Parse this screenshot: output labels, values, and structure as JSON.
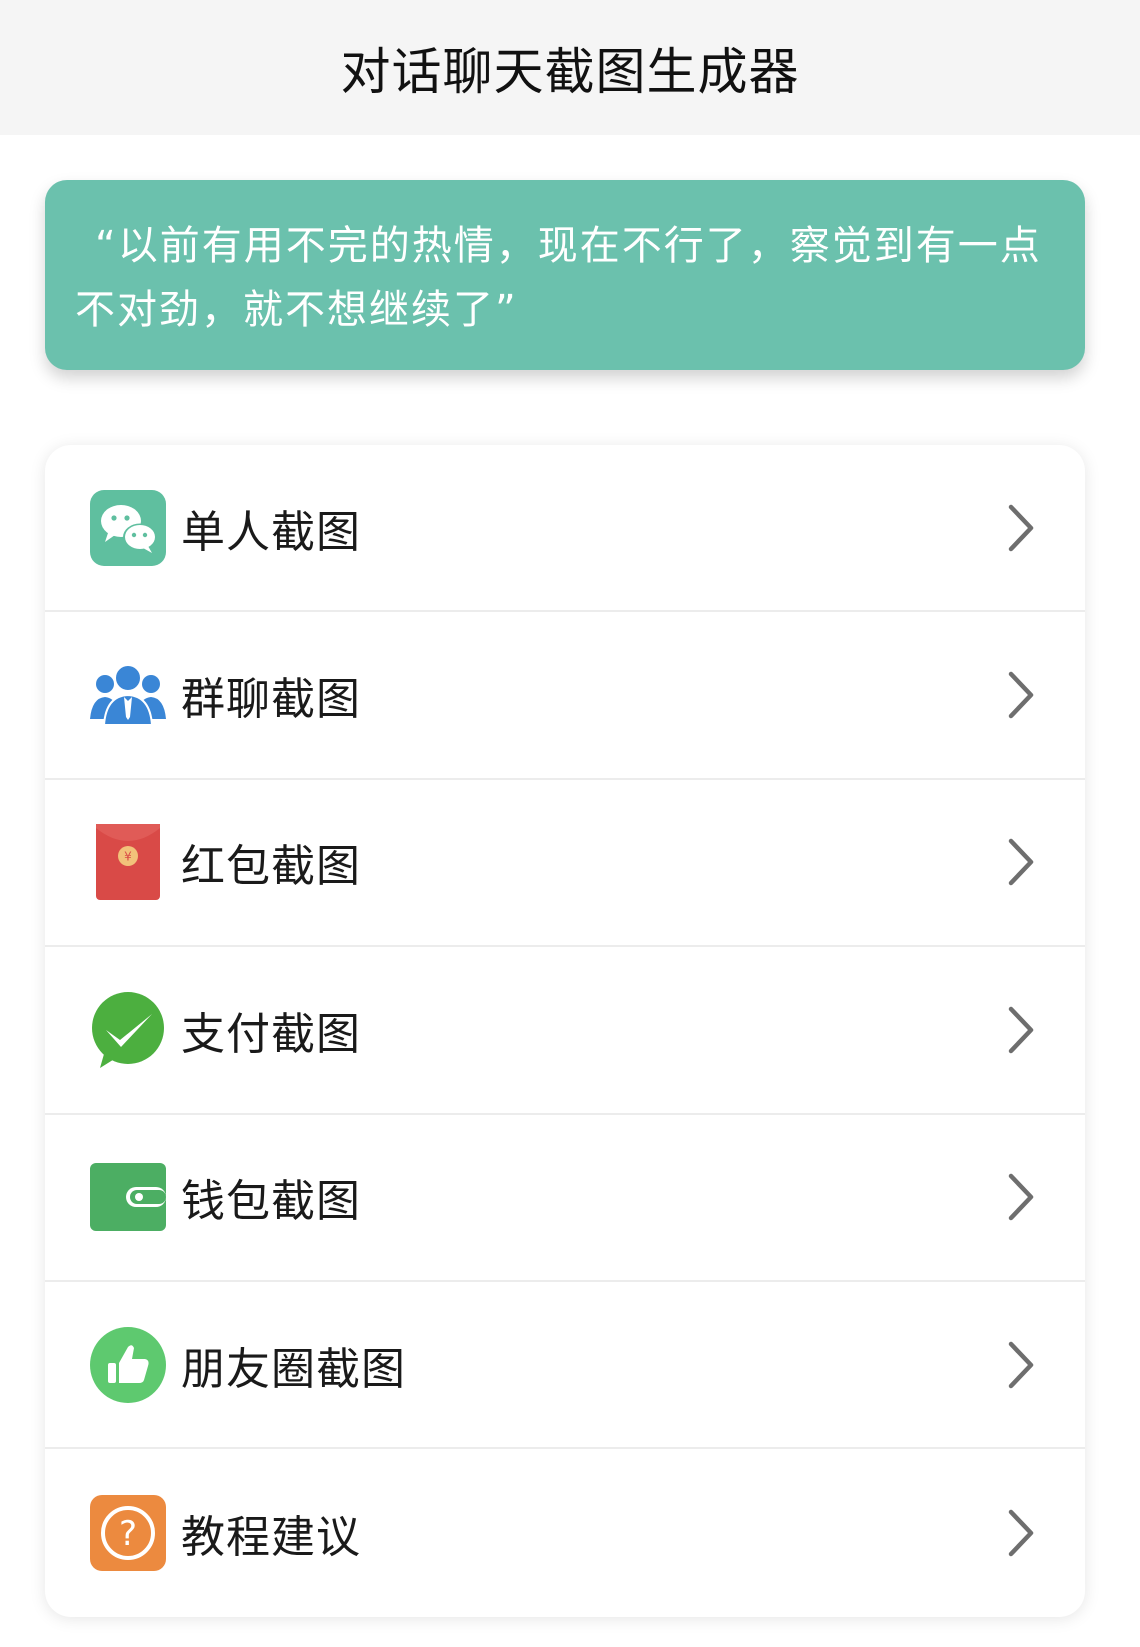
{
  "header": {
    "title": "对话聊天截图生成器"
  },
  "quote": {
    "text": "“以前有用不完的热情，现在不行了，察觉到有一点不对劲，就不想继续了”"
  },
  "menu": {
    "items": [
      {
        "label": "单人截图",
        "icon": "wechat-chat-icon",
        "color": "#5fbf9f"
      },
      {
        "label": "群聊截图",
        "icon": "group-users-icon",
        "color": "#3a86d6"
      },
      {
        "label": "红包截图",
        "icon": "red-packet-icon",
        "color": "#d94a47"
      },
      {
        "label": "支付截图",
        "icon": "payment-check-icon",
        "color": "#4caf3f"
      },
      {
        "label": "钱包截图",
        "icon": "wallet-icon",
        "color": "#4cae63"
      },
      {
        "label": "朋友圈截图",
        "icon": "thumbs-up-icon",
        "color": "#5ec96f"
      },
      {
        "label": "教程建议",
        "icon": "question-icon",
        "color": "#ec8a3f"
      }
    ]
  },
  "colors": {
    "accent": "#6bc1ad",
    "header_bg": "#f5f5f5",
    "chevron": "#6e6e6e"
  }
}
